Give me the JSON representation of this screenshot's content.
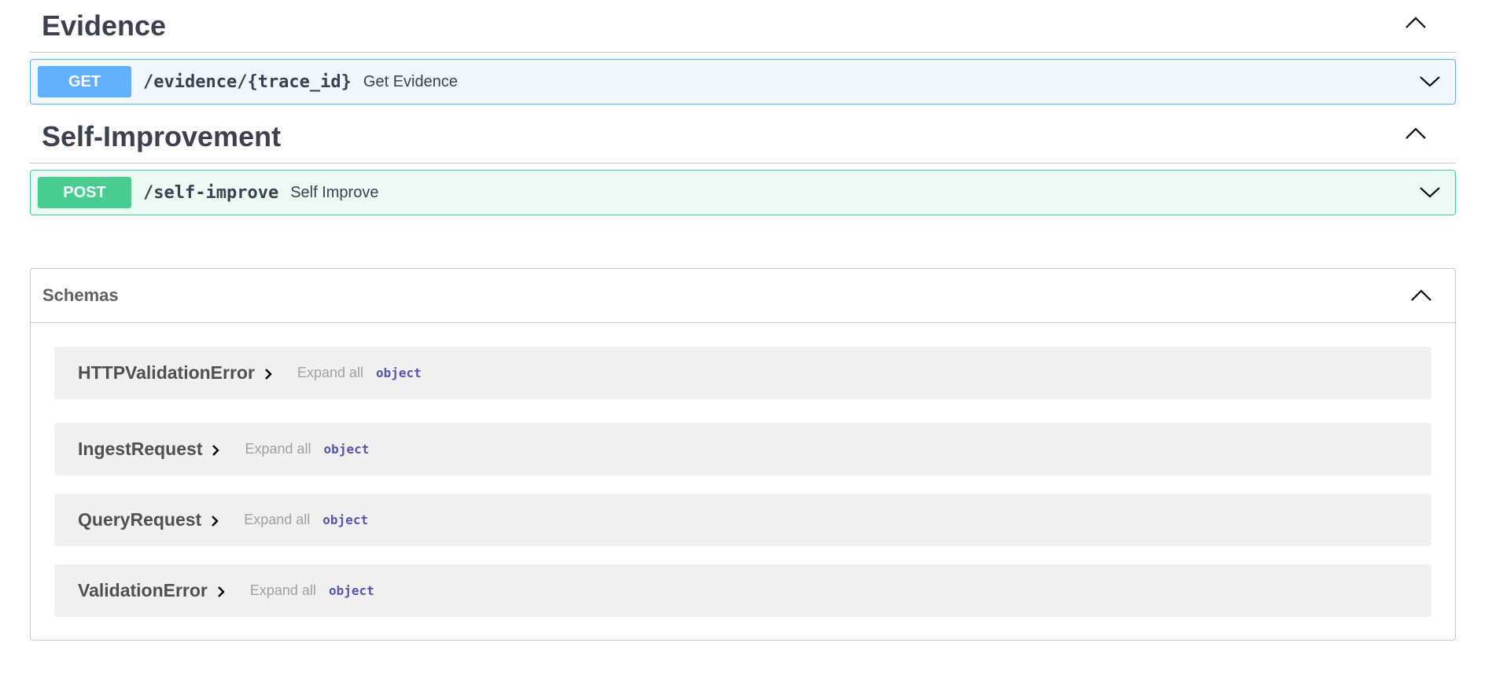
{
  "sections": {
    "evidence": {
      "title": "Evidence",
      "operation": {
        "method": "GET",
        "path": "/evidence/{trace_id}",
        "summary": "Get Evidence"
      }
    },
    "self_improvement": {
      "title": "Self-Improvement",
      "operation": {
        "method": "POST",
        "path": "/self-improve",
        "summary": "Self Improve"
      }
    }
  },
  "schemas": {
    "title": "Schemas",
    "expand_label": "Expand all",
    "models": [
      {
        "name": "HTTPValidationError",
        "type": "object"
      },
      {
        "name": "IngestRequest",
        "type": "object"
      },
      {
        "name": "QueryRequest",
        "type": "object"
      },
      {
        "name": "ValidationError",
        "type": "object"
      }
    ]
  },
  "colors": {
    "get": "#61affe",
    "post": "#49cc90",
    "text": "#3b4151",
    "model_bg": "#f0f0f0"
  },
  "icons": {
    "tag_toggle": "chevron-up-icon",
    "op_toggle": "chevron-down-icon",
    "model_expand": "chevron-right-icon"
  }
}
